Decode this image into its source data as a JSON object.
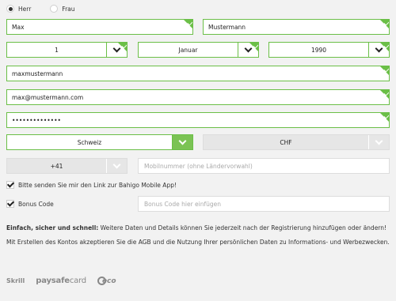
{
  "gender": {
    "options": [
      {
        "label": "Herr",
        "selected": true
      },
      {
        "label": "Frau",
        "selected": false
      }
    ]
  },
  "name": {
    "first": "Max",
    "last": "Mustermann"
  },
  "birth": {
    "day": "1",
    "month": "Januar",
    "year": "1990"
  },
  "username": "maxmustermann",
  "email": "max@mustermann.com",
  "password": "••••••••••••••",
  "country": "Schweiz",
  "currency": "CHF",
  "phone": {
    "prefix": "+41",
    "placeholder": "Mobilnummer (ohne Ländervorwahl)"
  },
  "app_link": {
    "label": "Bitte senden Sie mir den Link zur Bahigo Mobile App!",
    "checked": true
  },
  "bonus": {
    "label": "Bonus Code",
    "checked": true,
    "placeholder": "Bonus Code hier einfügen"
  },
  "info_text": {
    "bold": "Einfach, sicher und schnell:",
    "rest": " Weitere Daten und Details können Sie jederzeit nach der Registrierung hinzufügen oder ändern!"
  },
  "terms_text": "Mit Erstellen des Kontos akzeptieren Sie die AGB und die Nutzung Ihrer persönlichen Daten zu Informations- und Werbezwecken.",
  "payments": {
    "skrill": "Skrill",
    "psc_bold": "paysafe",
    "psc_light": "card",
    "eco": "eco"
  },
  "colors": {
    "accent": "#6bbf47",
    "background": "#f2f2f2"
  }
}
